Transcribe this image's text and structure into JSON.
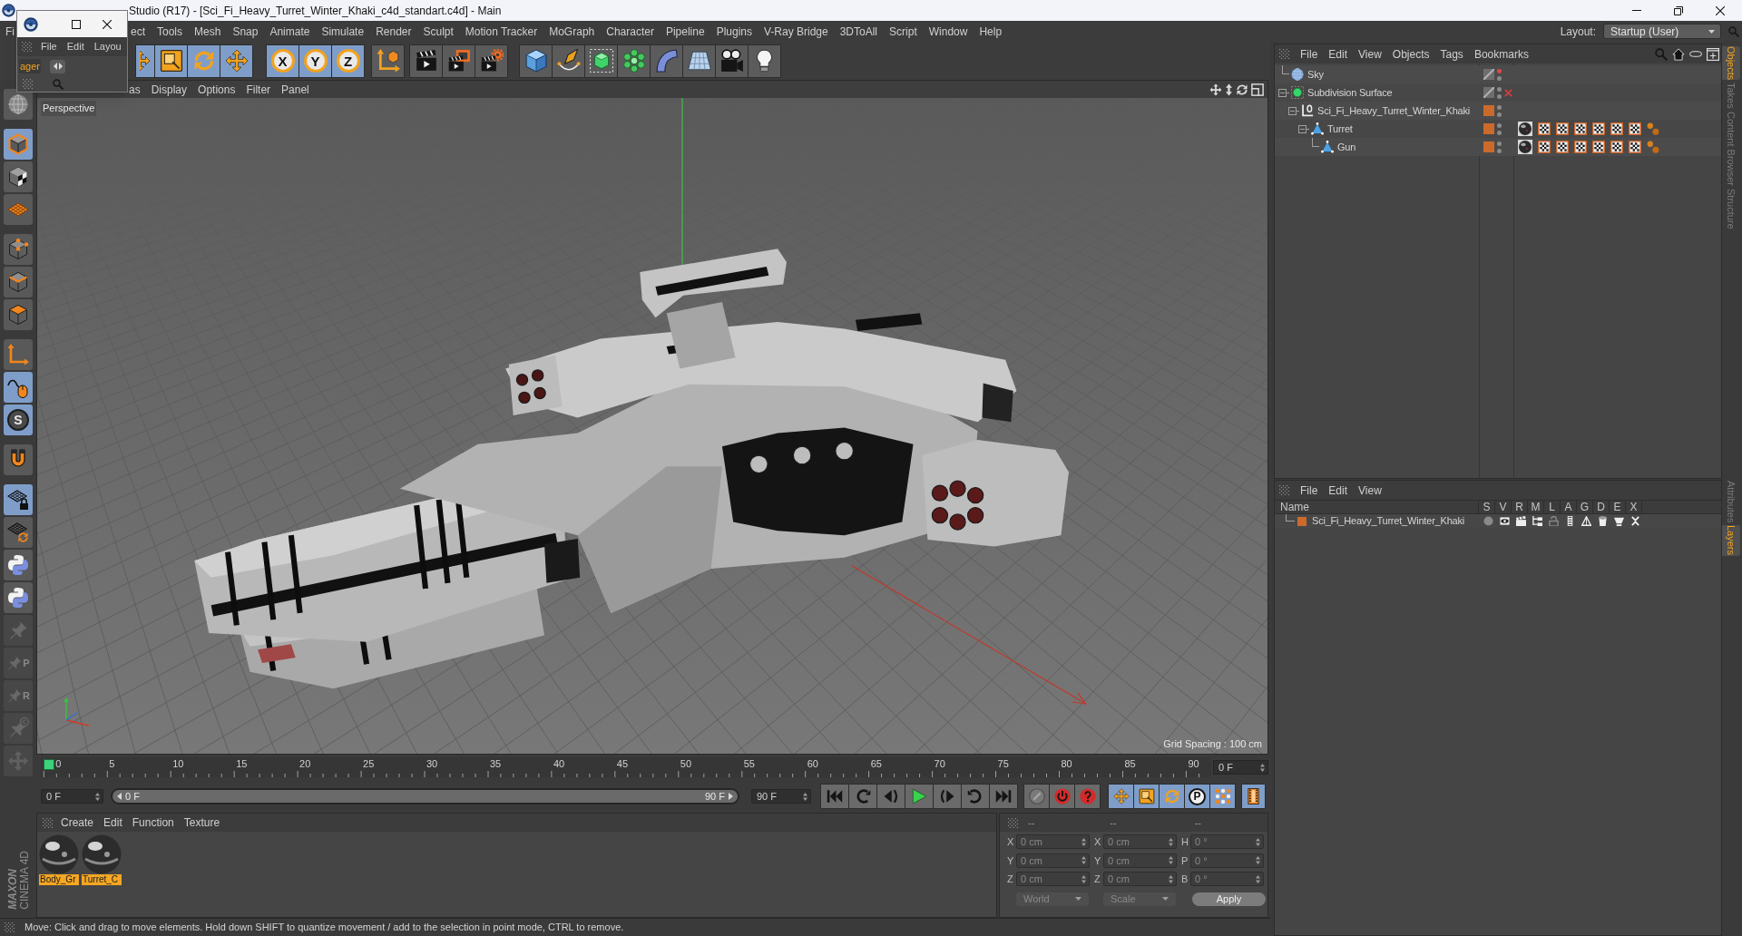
{
  "title_bar": {
    "title": "Studio (R17) - [Sci_Fi_Heavy_Turret_Winter_Khaki_c4d_standart.c4d] - Main"
  },
  "floating_window": {
    "menu": [
      "File",
      "Edit",
      "Layou"
    ],
    "tab": "ager"
  },
  "menu_bar": {
    "items": [
      "Fi",
      "ect",
      "Tools",
      "Mesh",
      "Snap",
      "Animate",
      "Simulate",
      "Render",
      "Sculpt",
      "Motion Tracker",
      "MoGraph",
      "Character",
      "Pipeline",
      "Plugins",
      "V-Ray Bridge",
      "3DToAll",
      "Script",
      "Window",
      "Help"
    ],
    "layout_label": "Layout:",
    "layout_value": "Startup (User)"
  },
  "toolbar": {
    "groups": [
      [
        {
          "selected": true
        },
        {
          "selected": true
        },
        {
          "selected": true
        },
        {
          "selected": true
        }
      ],
      [
        {
          "selected": true,
          "label": "X"
        },
        {
          "selected": true,
          "label": "Y"
        },
        {
          "selected": true,
          "label": "Z"
        }
      ],
      [
        {
          "selected": false
        }
      ],
      [
        {
          "selected": false
        },
        {
          "selected": false
        },
        {
          "selected": false
        }
      ],
      [
        {
          "selected": false
        },
        {
          "selected": false
        },
        {
          "selected": false
        },
        {
          "selected": false
        },
        {
          "selected": false
        },
        {
          "selected": false
        },
        {
          "selected": false
        },
        {
          "selected": false
        }
      ]
    ]
  },
  "left_toolbar": {
    "groups": [
      [
        {
          "selected": false,
          "disabled": false
        }
      ],
      [
        {
          "selected": true,
          "disabled": false
        },
        {
          "selected": false,
          "disabled": false
        },
        {
          "selected": false,
          "disabled": false
        }
      ],
      [
        {
          "selected": false,
          "disabled": false
        },
        {
          "selected": false,
          "disabled": false
        },
        {
          "selected": false,
          "disabled": false
        }
      ],
      [
        {
          "selected": false,
          "disabled": false
        },
        {
          "selected": true,
          "disabled": false
        },
        {
          "selected": true,
          "disabled": false,
          "label": "S"
        }
      ],
      [
        {
          "selected": false,
          "disabled": false
        }
      ],
      [
        {
          "selected": true,
          "disabled": false
        },
        {
          "selected": false,
          "disabled": false
        },
        {
          "selected": false,
          "disabled": false
        },
        {
          "selected": false,
          "disabled": false
        },
        {
          "selected": false,
          "disabled": true
        },
        {
          "selected": false,
          "disabled": true,
          "label": "P"
        },
        {
          "selected": false,
          "disabled": true,
          "label": "R"
        },
        {
          "selected": false,
          "disabled": true
        },
        {
          "selected": false,
          "disabled": true
        }
      ]
    ]
  },
  "logo": {
    "brand": "MAXON",
    "product": "CINEMA 4D"
  },
  "viewport": {
    "menu": [
      "as",
      "Display",
      "Options",
      "Filter",
      "Panel"
    ],
    "camera_label": "Perspective",
    "grid_spacing": "Grid Spacing : 100 cm"
  },
  "timeline": {
    "ticks": [
      "0",
      "5",
      "10",
      "15",
      "20",
      "25",
      "30",
      "35",
      "40",
      "45",
      "50",
      "55",
      "60",
      "65",
      "70",
      "75",
      "80",
      "85",
      "90"
    ],
    "level": 0,
    "current_frame": "0 F"
  },
  "transport": {
    "start_field": "0 F",
    "range_start": "0 F",
    "range_end": "90 F",
    "level": 1,
    "end_field": "90 F",
    "groups": [
      [
        {
          "selected": false
        },
        {
          "selected": false
        },
        {
          "selected": false
        },
        {
          "selected": false
        },
        {
          "selected": false
        },
        {
          "selected": false
        },
        {
          "selected": false
        }
      ],
      [
        {
          "selected": false
        },
        {
          "selected": false
        },
        {
          "selected": false
        }
      ],
      [
        {
          "selected": true
        },
        {
          "selected": true
        },
        {
          "selected": true
        },
        {
          "selected": true,
          "label": "P"
        },
        {
          "selected": true
        }
      ],
      [
        {
          "selected": true
        }
      ]
    ]
  },
  "material_manager": {
    "menu": [
      "Create",
      "Edit",
      "Function",
      "Texture"
    ],
    "materials": [
      {
        "name": "Body_Gr",
        "selected": true
      },
      {
        "name": "Turret_C",
        "selected": true
      }
    ]
  },
  "coordinates": {
    "headers": [
      "--",
      "--",
      "--"
    ],
    "rows": [
      {
        "cells": [
          {
            "label": "X",
            "value": "0 cm"
          },
          {
            "label": "X",
            "value": "0 cm"
          },
          {
            "label": "H",
            "value": "0 °"
          }
        ]
      },
      {
        "cells": [
          {
            "label": "Y",
            "value": "0 cm"
          },
          {
            "label": "Y",
            "value": "0 cm"
          },
          {
            "label": "P",
            "value": "0 °"
          }
        ]
      },
      {
        "cells": [
          {
            "label": "Z",
            "value": "0 cm"
          },
          {
            "label": "Z",
            "value": "0 cm"
          },
          {
            "label": "B",
            "value": "0 °"
          }
        ]
      }
    ],
    "mode": "World",
    "transform": "Scale",
    "apply": "Apply"
  },
  "status_bar": {
    "text": "Move: Click and drag to move elements. Hold down SHIFT to quantize movement / add to the selection in point mode, CTRL to remove."
  },
  "object_manager": {
    "menu": [
      "File",
      "Edit",
      "View",
      "Objects",
      "Tags",
      "Bookmarks"
    ],
    "objects": [
      {
        "name": "Sky",
        "kind": "sky",
        "hidden_in_editor": true
      },
      {
        "name": "Subdivision Surface",
        "kind": "subdivision",
        "hidden_in_editor": false,
        "enabled": false,
        "expanded": true,
        "children": [
          {
            "name": "Sci_Fi_Heavy_Turret_Winter_Khaki",
            "kind": "null",
            "hidden_in_editor": false,
            "color": "#cc6a2c",
            "expanded": true,
            "children": [
              {
                "name": "Turret",
                "kind": "polygon",
                "hidden_in_editor": false,
                "color": "#cc6a2c",
                "expanded": true,
                "tags": [
                  {
                    "kind": "material"
                  },
                  {
                    "kind": "checker"
                  },
                  {
                    "kind": "checker"
                  },
                  {
                    "kind": "checker"
                  },
                  {
                    "kind": "checker"
                  },
                  {
                    "kind": "checker"
                  },
                  {
                    "kind": "checker"
                  },
                  {
                    "kind": "phong"
                  }
                ],
                "children": [
                  {
                    "name": "Gun",
                    "kind": "polygon",
                    "hidden_in_editor": false,
                    "color": "#cc6a2c",
                    "tags": [
                      {
                        "kind": "material"
                      },
                      {
                        "kind": "checker"
                      },
                      {
                        "kind": "checker"
                      },
                      {
                        "kind": "checker"
                      },
                      {
                        "kind": "checker"
                      },
                      {
                        "kind": "checker"
                      },
                      {
                        "kind": "checker"
                      },
                      {
                        "kind": "phong"
                      }
                    ]
                  }
                ]
              }
            ]
          }
        ]
      }
    ]
  },
  "layer_manager": {
    "menu": [
      "File",
      "Edit",
      "View"
    ],
    "columns": [
      "Name",
      "S",
      "V",
      "R",
      "M",
      "L",
      "A",
      "G",
      "D",
      "E",
      "X"
    ],
    "layers": [
      {
        "name": "Sci_Fi_Heavy_Turret_Winter_Khaki",
        "color": "#cc6a2c",
        "toggles": [
          {
            "on": false
          },
          {
            "on": true
          },
          {
            "on": true
          },
          {
            "on": true
          },
          {
            "on": false
          },
          {
            "on": true
          },
          {
            "on": true
          },
          {
            "on": true
          },
          {
            "on": true
          },
          {
            "on": true
          }
        ]
      }
    ]
  },
  "side_tabs": {
    "top": [
      {
        "label": "Objects",
        "selected": true
      },
      {
        "label": "Takes",
        "selected": false
      },
      {
        "label": "Content Browser",
        "selected": false
      },
      {
        "label": "Structure",
        "selected": false
      }
    ],
    "bottom": [
      {
        "label": "Attributes",
        "selected": false
      },
      {
        "label": "Layers",
        "selected": true
      }
    ]
  }
}
